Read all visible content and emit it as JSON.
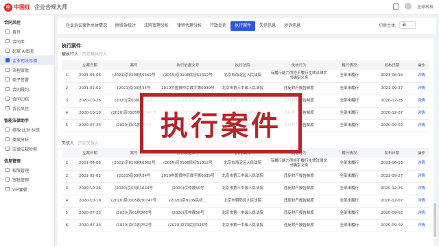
{
  "header": {
    "logo_text": "中国红",
    "logo_glyph": "中",
    "app_title": "企业合规大师",
    "company": "全球科技"
  },
  "sidebar": {
    "groups": [
      {
        "title": "合同风控",
        "items": [
          {
            "label": "首页",
            "active": false
          },
          {
            "label": "合同库",
            "active": false
          },
          {
            "label": "起草·AI审查",
            "active": false
          },
          {
            "label": "企业司法尽调",
            "active": true
          },
          {
            "label": "流程审批",
            "active": false
          },
          {
            "label": "电子签署",
            "active": false
          },
          {
            "label": "合同履约",
            "active": false
          },
          {
            "label": "合同归档",
            "active": false
          },
          {
            "label": "诉讼风控",
            "active": false
          }
        ]
      },
      {
        "title": "智能法律助手",
        "items": [
          {
            "label": "排版·比对·纠错",
            "active": false
          },
          {
            "label": "类案分析",
            "active": false
          },
          {
            "label": "法律法规检索",
            "active": false
          }
        ]
      },
      {
        "title": "信息管理",
        "items": [
          {
            "label": "权限管理",
            "active": false
          },
          {
            "label": "审批管理",
            "active": false
          },
          {
            "label": "VIP套餐",
            "active": false
          }
        ]
      }
    ]
  },
  "tabs": {
    "items": [
      {
        "label": "企业诉讼案件总体情况",
        "active": false
      },
      {
        "label": "胜败诉统计",
        "active": false
      },
      {
        "label": "法院审理分析",
        "active": false
      },
      {
        "label": "律师代理分析",
        "active": false
      },
      {
        "label": "行政处罚",
        "active": false
      },
      {
        "label": "执行案件",
        "active": true
      },
      {
        "label": "失信信息",
        "active": false
      },
      {
        "label": "涉诉信息",
        "active": false
      }
    ],
    "switch_label": "切换主体:",
    "switch_value": "弟"
  },
  "section1": {
    "title": "执行案件",
    "sub_tab_on": "被执行人",
    "sub_tab_off": "历史被执行人"
  },
  "section2": {
    "sub_tab_on": "失信人",
    "sub_tab_off": "历史失信人"
  },
  "table_headers": [
    "",
    "立案日期",
    "案号",
    "执行依据文号",
    "执行法院",
    "失信行为",
    "履行情况",
    "发布日期",
    "操作"
  ],
  "table1_rows": [
    [
      "1",
      "2021-04-06",
      "(2021)京0108执6562号",
      "(2019)京0108民初51312号",
      "北京市海淀区人民法院",
      "有履行能力而拒不履行生效法律文书确定义务",
      "全部未履行",
      "2021-06-16",
      "详情"
    ],
    [
      "2",
      "2021-02-02",
      "(2021)京03执34号",
      "2019中国贸仲京裁字第0939号",
      "北京市第三中级人民法院",
      "违反财产报告制度",
      "全部未履行",
      "2021-09-27",
      "详情"
    ],
    [
      "3",
      "2020-10-26",
      "(2020)京03执1634号",
      "(2020)京仲裁50号",
      "北京市第三中级人民法院",
      "违反财产报告制度",
      "全部未履行",
      "2020-12-25",
      "详情"
    ],
    [
      "4",
      "2020-10-19",
      "(2020)京0105执30747号",
      "(2020)京0105民初...",
      "北京市朝阳区人民法院",
      "违反财产报告制度",
      "全部未履行",
      "2020-12-07",
      "详情"
    ],
    [
      "5",
      "2020-07-23",
      "(2020)京01执760号",
      "(2020)京仲裁50号",
      "北京市第一中级人民法院",
      "违反财产报告制度",
      "全部未履行",
      "2020-09-02",
      "详情"
    ]
  ],
  "table2_rows": [
    [
      "1",
      "2021-04-06",
      "(2021)京0108执6562号",
      "(2019)京0108民初51312号",
      "北京市海淀区人民法院",
      "有履行能力而拒不履行生效法律文书确定义务",
      "全部未履行",
      "2021-06-16",
      "详情"
    ],
    [
      "2",
      "2021-02-02",
      "(2021)京03执34号",
      "2019中国贸仲京裁字第0939号",
      "北京市第三中级人民法院",
      "违反财产报告制度",
      "全部未履行",
      "2021-09-27",
      "详情"
    ],
    [
      "3",
      "2020-10-26",
      "(2020)京03执1634号",
      "(2020)京仲裁50号",
      "北京市第三中级人民法院",
      "违反财产报告制度",
      "全部未履行",
      "2020-12-25",
      "详情"
    ],
    [
      "4",
      "2020-10-19",
      "(2020)京0105执30747号",
      "(2020)京0105民初...",
      "北京市朝阳区人民法院",
      "违反财产报告制度",
      "全部未履行",
      "2020-12-07",
      "详情"
    ],
    [
      "5",
      "2020-07-23",
      "(2020)京01执760号",
      "(2020)京仲裁50号",
      "北京市第一中级人民法院",
      "违反财产报告制度",
      "全部未履行",
      "2020-09-02",
      "详情"
    ],
    [
      "6",
      "2020-07-23",
      "(2020)京01执752号",
      "(2020)京73民初326号",
      "北京市第一中级人民法院",
      "违反财产报告制度",
      "全部未履行",
      "2020-09-02",
      "详情"
    ]
  ],
  "overlay": {
    "text": "执行案件"
  },
  "colors": {
    "accent": "#2f54eb",
    "brand_red": "#e2231a",
    "overlay_red": "#b52429"
  }
}
